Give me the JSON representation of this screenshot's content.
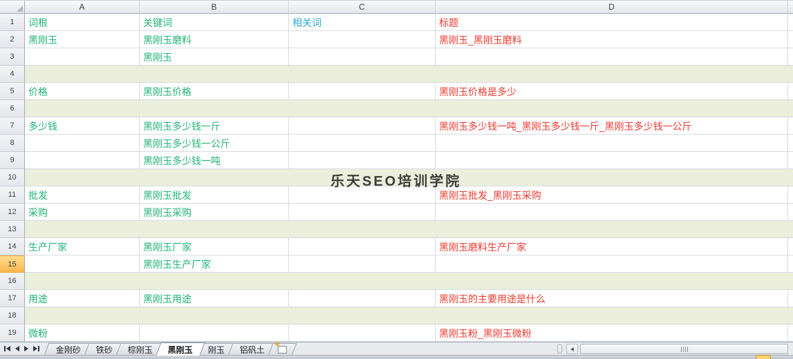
{
  "colors": {
    "green": "#22B377",
    "red": "#EE3B30",
    "blue": "#2EA7DB",
    "band": "#EBEFDB",
    "gridline": "#D6DBE4",
    "selected_row_header": "#F9B64F",
    "watermark_text": "#3C3C3C"
  },
  "watermark": {
    "text": "乐天SEO培训学院"
  },
  "grid": {
    "columns": [
      "A",
      "B",
      "C",
      "D"
    ],
    "rows": [
      {
        "n": "1",
        "band": false,
        "selected": false,
        "cells": {
          "A": {
            "t": "词根",
            "c": "green"
          },
          "B": {
            "t": "关键词",
            "c": "green"
          },
          "C": {
            "t": "相关词",
            "c": "blue"
          },
          "D": {
            "t": "标题",
            "c": "red"
          }
        }
      },
      {
        "n": "2",
        "band": false,
        "selected": false,
        "cells": {
          "A": {
            "t": "黑刚玉",
            "c": "green"
          },
          "B": {
            "t": "黑刚玉磨料",
            "c": "green"
          },
          "D": {
            "t": "黑刚玉_黑刚玉磨料",
            "c": "red"
          }
        }
      },
      {
        "n": "3",
        "band": false,
        "selected": false,
        "cells": {
          "B": {
            "t": "黑刚玉",
            "c": "green"
          }
        }
      },
      {
        "n": "4",
        "band": true,
        "selected": false,
        "cells": {}
      },
      {
        "n": "5",
        "band": false,
        "selected": false,
        "cells": {
          "A": {
            "t": "价格",
            "c": "green"
          },
          "B": {
            "t": "黑刚玉价格",
            "c": "green"
          },
          "D": {
            "t": "黑刚玉价格是多少",
            "c": "red"
          }
        }
      },
      {
        "n": "6",
        "band": true,
        "selected": false,
        "cells": {}
      },
      {
        "n": "7",
        "band": false,
        "selected": false,
        "cells": {
          "A": {
            "t": "多少钱",
            "c": "green"
          },
          "B": {
            "t": "黑刚玉多少钱一斤",
            "c": "green"
          },
          "D": {
            "t": "黑刚玉多少钱一吨_黑刚玉多少钱一斤_黑刚玉多少钱一公斤",
            "c": "red"
          }
        }
      },
      {
        "n": "8",
        "band": false,
        "selected": false,
        "cells": {
          "B": {
            "t": "黑刚玉多少钱一公斤",
            "c": "green"
          }
        }
      },
      {
        "n": "9",
        "band": false,
        "selected": false,
        "cells": {
          "B": {
            "t": "黑刚玉多少钱一吨",
            "c": "green"
          }
        }
      },
      {
        "n": "10",
        "band": true,
        "selected": false,
        "cells": {}
      },
      {
        "n": "11",
        "band": false,
        "selected": false,
        "cells": {
          "A": {
            "t": "批发",
            "c": "green"
          },
          "B": {
            "t": "黑刚玉批发",
            "c": "green"
          },
          "D": {
            "t": "黑刚玉批发_黑刚玉采购",
            "c": "red"
          }
        }
      },
      {
        "n": "12",
        "band": false,
        "selected": false,
        "cells": {
          "A": {
            "t": "采购",
            "c": "green"
          },
          "B": {
            "t": "黑刚玉采购",
            "c": "green"
          }
        }
      },
      {
        "n": "13",
        "band": true,
        "selected": false,
        "cells": {}
      },
      {
        "n": "14",
        "band": false,
        "selected": false,
        "cells": {
          "A": {
            "t": "生产厂家",
            "c": "green"
          },
          "B": {
            "t": "黑刚玉厂家",
            "c": "green"
          },
          "D": {
            "t": "黑刚玉磨料生产厂家",
            "c": "red"
          }
        }
      },
      {
        "n": "15",
        "band": false,
        "selected": true,
        "cells": {
          "B": {
            "t": "黑刚玉生产厂家",
            "c": "green"
          }
        }
      },
      {
        "n": "16",
        "band": true,
        "selected": false,
        "cells": {}
      },
      {
        "n": "17",
        "band": false,
        "selected": false,
        "cells": {
          "A": {
            "t": "用途",
            "c": "green"
          },
          "B": {
            "t": "黑刚玉用途",
            "c": "green"
          },
          "D": {
            "t": "黑刚玉的主要用途是什么",
            "c": "red"
          }
        }
      },
      {
        "n": "18",
        "band": true,
        "selected": false,
        "cells": {}
      },
      {
        "n": "19",
        "band": false,
        "selected": false,
        "cells": {
          "A": {
            "t": "微粉",
            "c": "green"
          },
          "D": {
            "t": "黑刚玉粉_黑刚玉微粉",
            "c": "red"
          }
        }
      }
    ]
  },
  "tabbar": {
    "nav": [
      {
        "name": "first-sheet-icon"
      },
      {
        "name": "prev-sheet-icon"
      },
      {
        "name": "next-sheet-icon"
      },
      {
        "name": "last-sheet-icon"
      }
    ],
    "tabs": [
      {
        "label": "金刚砂",
        "active": false
      },
      {
        "label": "铁砂",
        "active": false
      },
      {
        "label": "棕刚玉",
        "active": false
      },
      {
        "label": "黑刚玉",
        "active": true
      },
      {
        "label": "刚玉",
        "active": false
      },
      {
        "label": "铝矾土",
        "active": false
      }
    ],
    "insert_icon": "insert-worksheet-icon",
    "insert_star": "✳"
  }
}
